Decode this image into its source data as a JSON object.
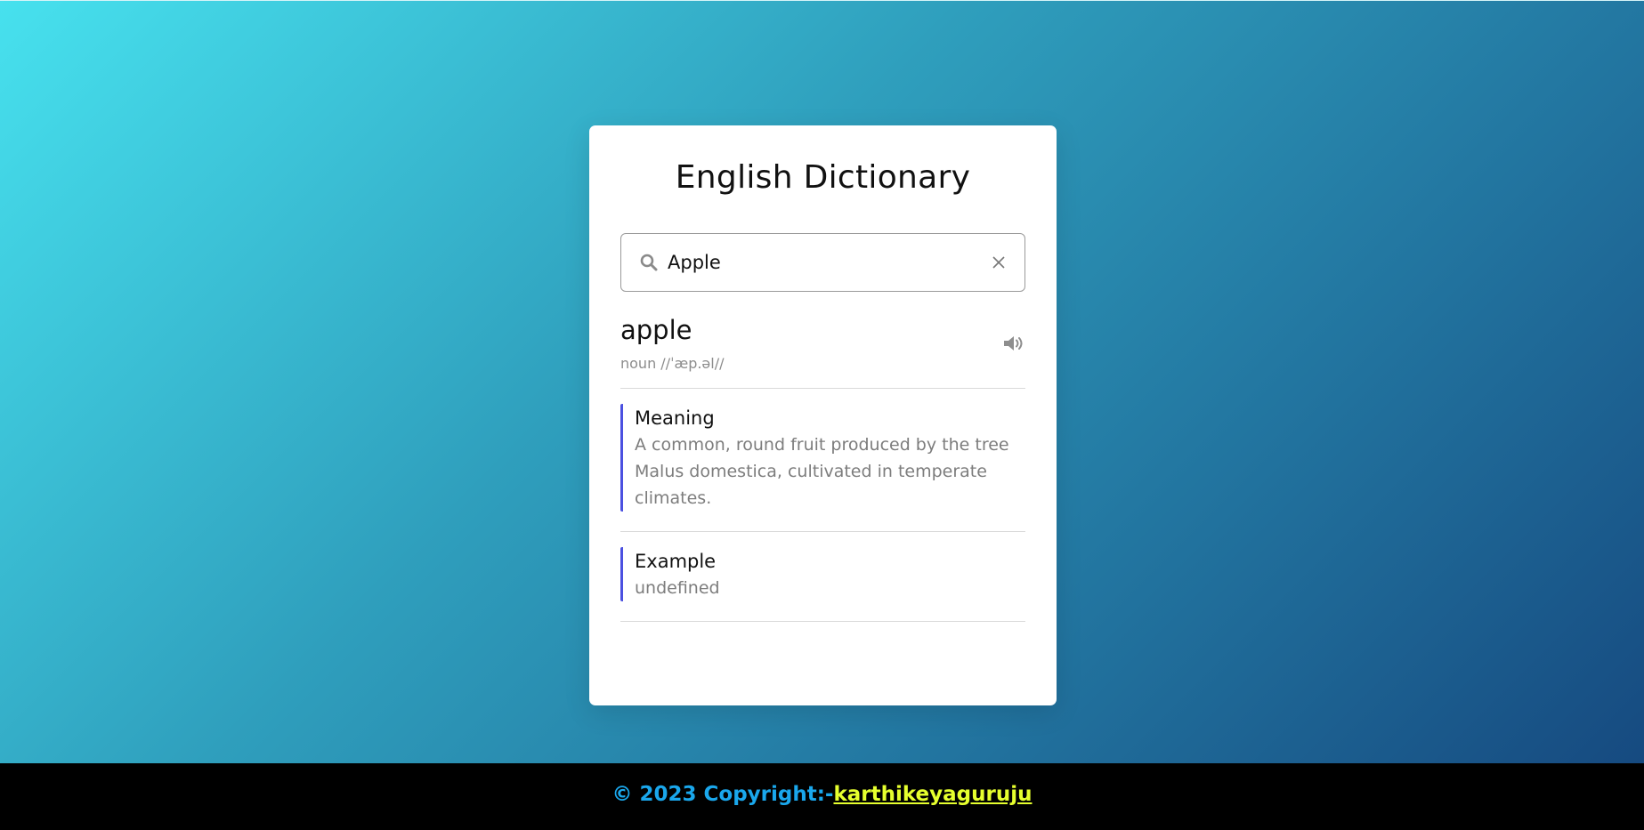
{
  "app": {
    "title": "English Dictionary"
  },
  "search": {
    "value": "Apple",
    "placeholder": "",
    "icon": "search-icon",
    "clear_icon": "close-icon"
  },
  "result": {
    "word": "apple",
    "phonetic": "noun //ˈæp.əl//",
    "audio_icon": "volume-icon"
  },
  "meaning": {
    "title": "Meaning",
    "text": "A common, round fruit produced by the tree Malus domestica, cultivated in temperate climates."
  },
  "example": {
    "title": "Example",
    "text": "undefined"
  },
  "footer": {
    "copyright": "© 2023 Copyright:-",
    "author": "karthikeyaguruju"
  },
  "colors": {
    "accent_border": "#4b50e0",
    "footer_text": "#1aa7ec",
    "footer_link": "#e6ff2e",
    "bg_gradient_start": "#47e1ee",
    "bg_gradient_end": "#164a80"
  }
}
